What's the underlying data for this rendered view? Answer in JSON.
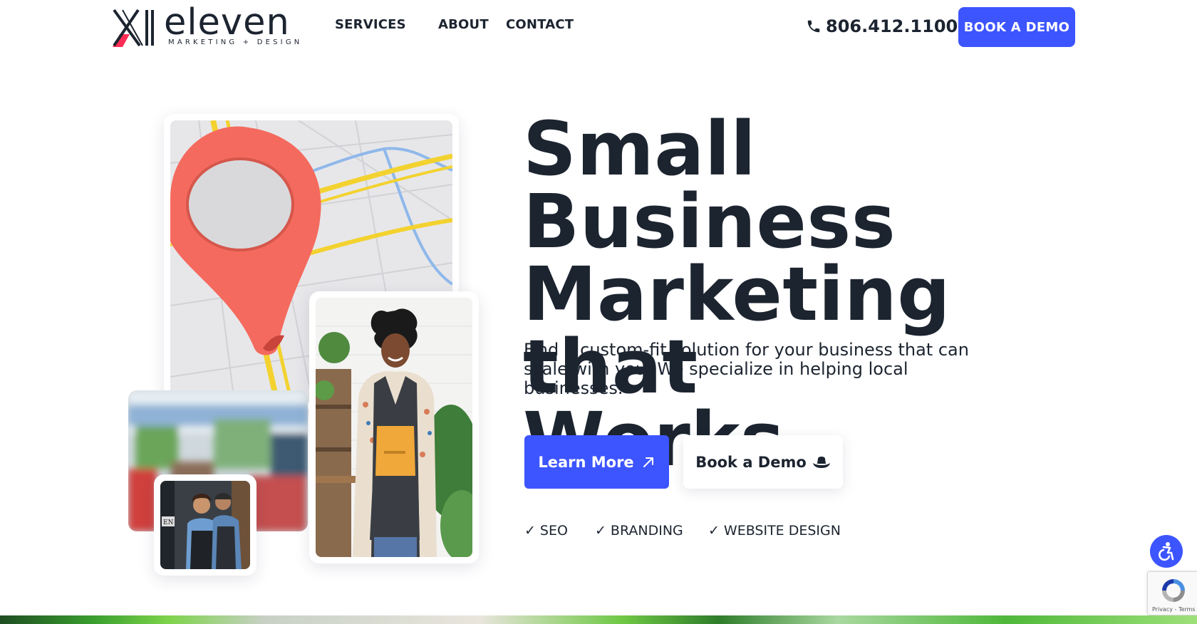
{
  "header": {
    "logo_word": "eleven",
    "logo_sub": "MARKETING + DESIGN",
    "nav": [
      "SERVICES",
      "ABOUT",
      "CONTACT"
    ],
    "phone": "806.412.1100",
    "cta": "BOOK A DEMO"
  },
  "hero": {
    "headline_lines": [
      "Small Business",
      "Marketing that",
      "Works."
    ],
    "subheadline": "Find a custom-fit solution for your business that can scale with you. We specialize in helping local businesses.",
    "primary_button": "Learn More",
    "secondary_button": "Book a Demo",
    "services": [
      "SEO",
      "BRANDING",
      "WEBSITE DESIGN"
    ]
  },
  "recaptcha": {
    "terms": "Privacy - Terms"
  },
  "colors": {
    "accent": "#3d55ff",
    "text": "#1c2430",
    "logo_pink": "#ff2d55",
    "pin_red": "#f56a5e"
  }
}
